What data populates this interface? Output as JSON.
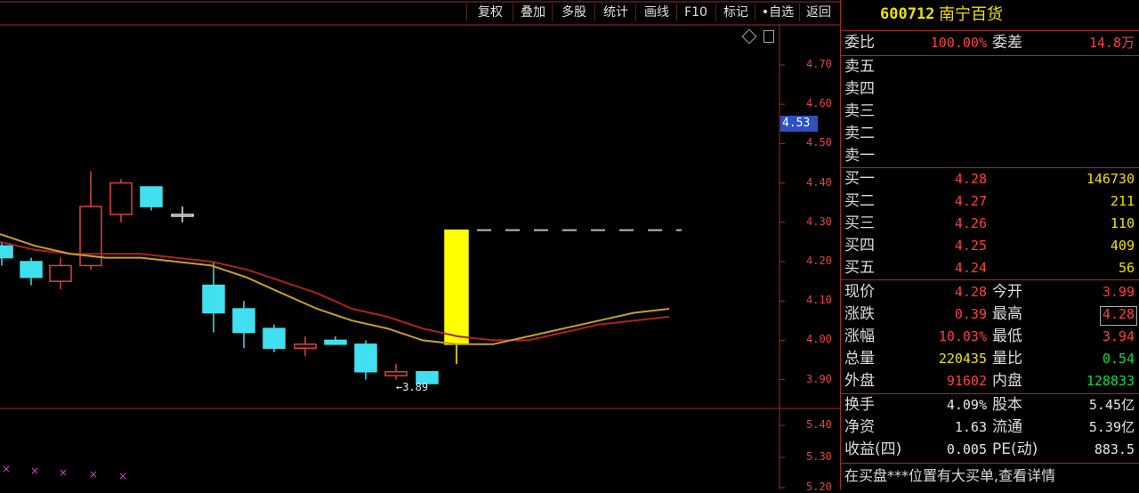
{
  "toolbar": {
    "buttons": [
      "复权",
      "叠加",
      "多股",
      "统计",
      "画线",
      "F10",
      "标记",
      "•自选",
      "返回"
    ]
  },
  "chart": {
    "price_axis": [
      "4.70",
      "4.60",
      "4.50",
      "4.40",
      "4.30",
      "4.20",
      "4.10",
      "4.00",
      "3.90"
    ],
    "lower_axis": [
      "5.40",
      "5.30",
      "5.20"
    ],
    "current_price_tag": "4.53",
    "low_marker_label": "3.89",
    "colors": {
      "up": "#e04040",
      "down": "#40e0f0",
      "limit_up": "#ffff00",
      "ma_short": "#c8a020",
      "ma_long": "#b02020",
      "axis": "#a52a2a"
    }
  },
  "chart_data": {
    "type": "candlestick",
    "ylim": [
      3.85,
      4.78
    ],
    "candles": [
      {
        "open": 4.24,
        "close": 4.21,
        "high": 4.25,
        "low": 4.19,
        "color": "down"
      },
      {
        "open": 4.2,
        "close": 4.16,
        "high": 4.21,
        "low": 4.14,
        "color": "down"
      },
      {
        "open": 4.15,
        "close": 4.19,
        "high": 4.21,
        "low": 4.13,
        "color": "up"
      },
      {
        "open": 4.19,
        "close": 4.34,
        "high": 4.43,
        "low": 4.18,
        "color": "up"
      },
      {
        "open": 4.32,
        "close": 4.4,
        "high": 4.41,
        "low": 4.3,
        "color": "up"
      },
      {
        "open": 4.39,
        "close": 4.34,
        "high": 4.39,
        "low": 4.33,
        "color": "down"
      },
      {
        "open": 4.32,
        "close": 4.32,
        "high": 4.34,
        "low": 4.3,
        "color": "doji"
      },
      {
        "open": 4.14,
        "close": 4.07,
        "high": 4.2,
        "low": 4.02,
        "color": "down"
      },
      {
        "open": 4.08,
        "close": 4.02,
        "high": 4.1,
        "low": 3.98,
        "color": "down"
      },
      {
        "open": 4.03,
        "close": 3.98,
        "high": 4.04,
        "low": 3.97,
        "color": "down"
      },
      {
        "open": 3.99,
        "close": 3.98,
        "high": 4.01,
        "low": 3.96,
        "color": "up"
      },
      {
        "open": 4.0,
        "close": 3.99,
        "high": 4.01,
        "low": 3.99,
        "color": "down"
      },
      {
        "open": 3.99,
        "close": 3.92,
        "high": 4.0,
        "low": 3.9,
        "color": "down"
      },
      {
        "open": 3.92,
        "close": 3.91,
        "high": 3.94,
        "low": 3.9,
        "color": "up"
      },
      {
        "open": 3.92,
        "close": 3.89,
        "high": 3.92,
        "low": 3.89,
        "color": "down"
      },
      {
        "open": 3.99,
        "close": 4.28,
        "high": 4.28,
        "low": 3.94,
        "color": "limit_up"
      }
    ],
    "ma_short": [
      4.27,
      4.24,
      4.22,
      4.21,
      4.21,
      4.2,
      4.19,
      4.16,
      4.12,
      4.08,
      4.05,
      4.03,
      4.0,
      3.99,
      3.99,
      4.01,
      4.03,
      4.05,
      4.07,
      4.08
    ],
    "ma_long": [
      4.25,
      4.23,
      4.22,
      4.22,
      4.22,
      4.21,
      4.2,
      4.18,
      4.15,
      4.12,
      4.08,
      4.06,
      4.03,
      4.01,
      4.0,
      4.0,
      4.02,
      4.04,
      4.05,
      4.06
    ]
  },
  "panel": {
    "header": {
      "code": "600712",
      "name": "南宁百货"
    },
    "weibi": {
      "label": "委比",
      "value": "100.00%",
      "diff_label": "委差",
      "diff_value": "14.8万"
    },
    "sell": [
      {
        "label": "卖五"
      },
      {
        "label": "卖四"
      },
      {
        "label": "卖三"
      },
      {
        "label": "卖二"
      },
      {
        "label": "卖一"
      }
    ],
    "buy": [
      {
        "label": "买一",
        "price": "4.28",
        "vol": "146730"
      },
      {
        "label": "买二",
        "price": "4.27",
        "vol": "211"
      },
      {
        "label": "买三",
        "price": "4.26",
        "vol": "110"
      },
      {
        "label": "买四",
        "price": "4.25",
        "vol": "409"
      },
      {
        "label": "买五",
        "price": "4.24",
        "vol": "56"
      }
    ],
    "quote": [
      {
        "l1": "现价",
        "v1": "4.28",
        "c1": "red",
        "l2": "今开",
        "v2": "3.99",
        "c2": "red"
      },
      {
        "l1": "涨跌",
        "v1": "0.39",
        "c1": "red",
        "l2": "最高",
        "v2": "4.28",
        "c2": "red"
      },
      {
        "l1": "涨幅",
        "v1": "10.03%",
        "c1": "red",
        "l2": "最低",
        "v2": "3.94",
        "c2": "red"
      },
      {
        "l1": "总量",
        "v1": "220435",
        "c1": "yellow",
        "l2": "量比",
        "v2": "0.54",
        "c2": "green"
      },
      {
        "l1": "外盘",
        "v1": "91602",
        "c1": "red",
        "l2": "内盘",
        "v2": "128833",
        "c2": "green"
      }
    ],
    "stats": [
      {
        "l1": "换手",
        "v1": "4.09%",
        "l2": "股本",
        "v2": "5.45亿"
      },
      {
        "l1": "净资",
        "v1": "1.63",
        "l2": "流通",
        "v2": "5.39亿"
      },
      {
        "l1": "收益(四)",
        "v1": "0.005",
        "l2": "PE(动)",
        "v2": "883.5"
      }
    ],
    "footer": "在买盘***位置有大买单,查看详情"
  }
}
